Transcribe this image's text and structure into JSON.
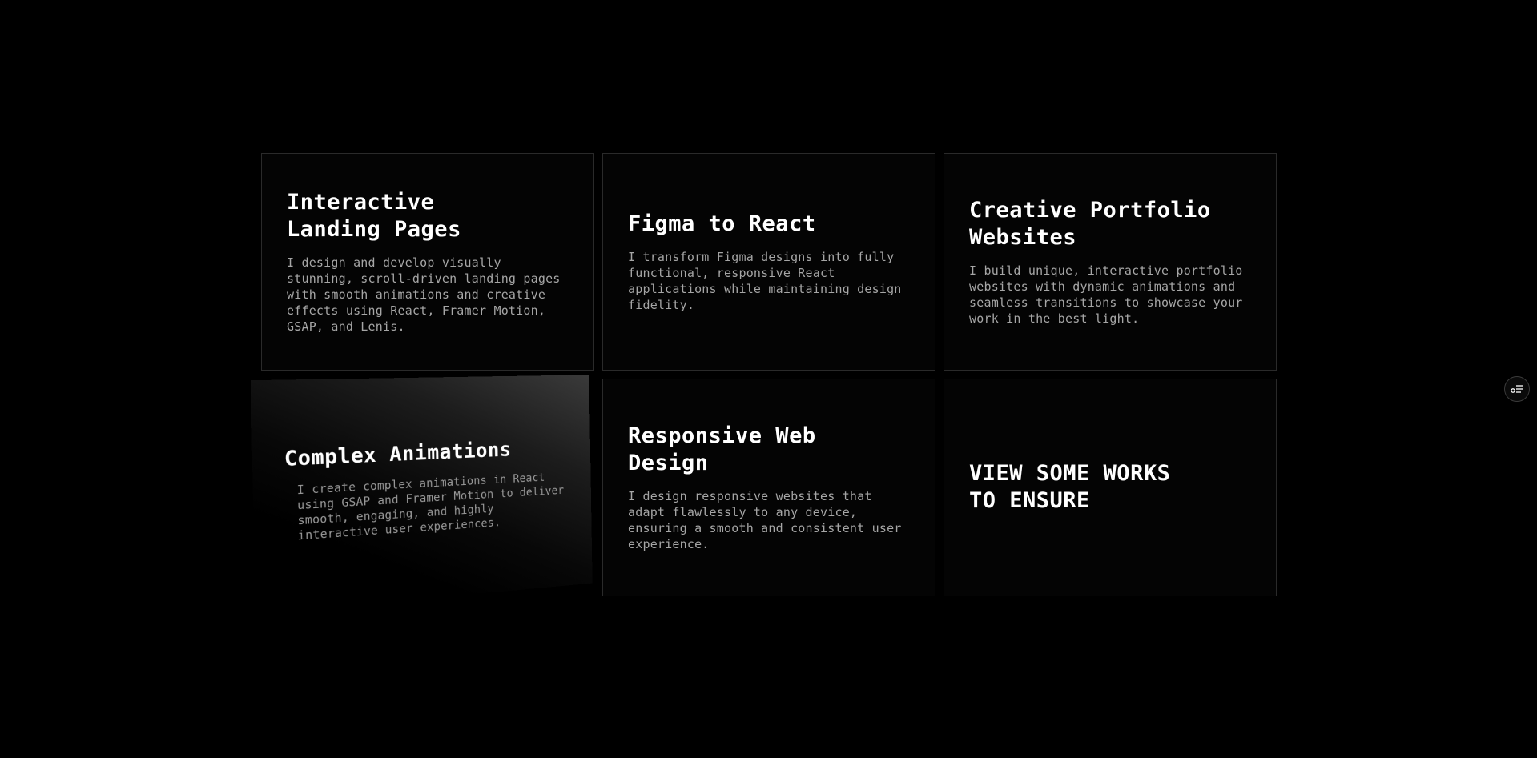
{
  "services": [
    {
      "title_line1": "Interactive",
      "title_line2": "Landing Pages",
      "description": "I design and develop visually stunning, scroll-driven landing pages with smooth animations and creative effects using React, Framer Motion, GSAP, and Lenis."
    },
    {
      "title_line1": "Figma to React",
      "title_line2": "",
      "description": "I transform Figma designs into fully functional, responsive React applications while maintaining design fidelity."
    },
    {
      "title_line1": "Creative Portfolio",
      "title_line2": "Websites",
      "description": "I build unique, interactive portfolio websites with dynamic animations and seamless transitions to showcase your work in the best light."
    },
    {
      "title_line1": "Complex Animations",
      "title_line2": "",
      "description": "I create complex animations in React using GSAP and Framer Motion to deliver smooth, engaging, and highly interactive user experiences."
    },
    {
      "title_line1": "Responsive Web",
      "title_line2": "Design",
      "description": "I design responsive websites that adapt flawlessly to any device, ensuring a smooth and consistent user experience."
    }
  ],
  "cta": {
    "line1": "VIEW SOME WORKS",
    "line2": "TO ENSURE"
  },
  "side_button": {
    "icon": "settings-list-icon"
  },
  "colors": {
    "background": "#000000",
    "card_border": "#2a2a2a",
    "title": "#ffffff",
    "description": "#a6a6a6"
  }
}
